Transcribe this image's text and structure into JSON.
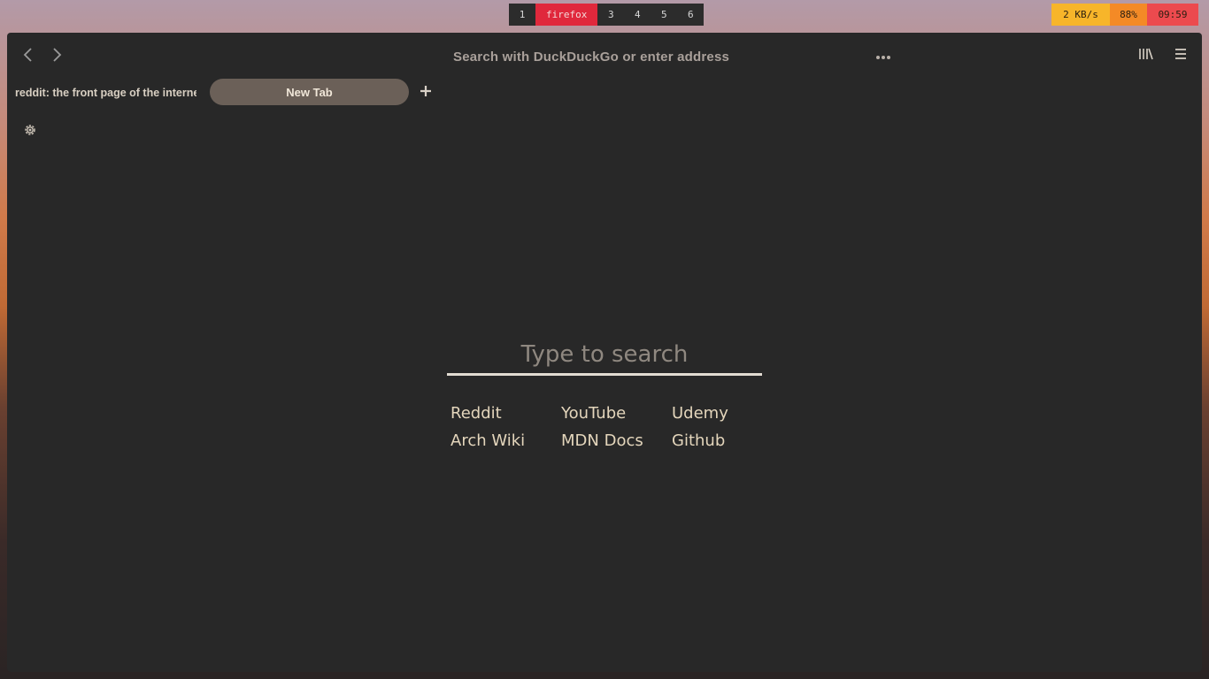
{
  "workspaces": [
    "1",
    "firefox",
    "3",
    "4",
    "5",
    "6"
  ],
  "active_workspace": "firefox",
  "status": {
    "net": "2 KB/s",
    "battery": "88%",
    "clock": "09:59"
  },
  "browser": {
    "url_placeholder": "Search with DuckDuckGo or enter address",
    "tabs": [
      {
        "label": "reddit: the front page of the internet"
      },
      {
        "label": "New Tab"
      }
    ]
  },
  "newtab": {
    "search_placeholder": "Type to search",
    "links": [
      "Reddit",
      "YouTube",
      "Udemy",
      "Arch Wiki",
      "MDN Docs",
      "Github"
    ]
  },
  "icons": [
    "back-icon",
    "forward-icon",
    "more-icon",
    "library-icon",
    "menu-icon",
    "plus-icon",
    "gear-icon"
  ]
}
